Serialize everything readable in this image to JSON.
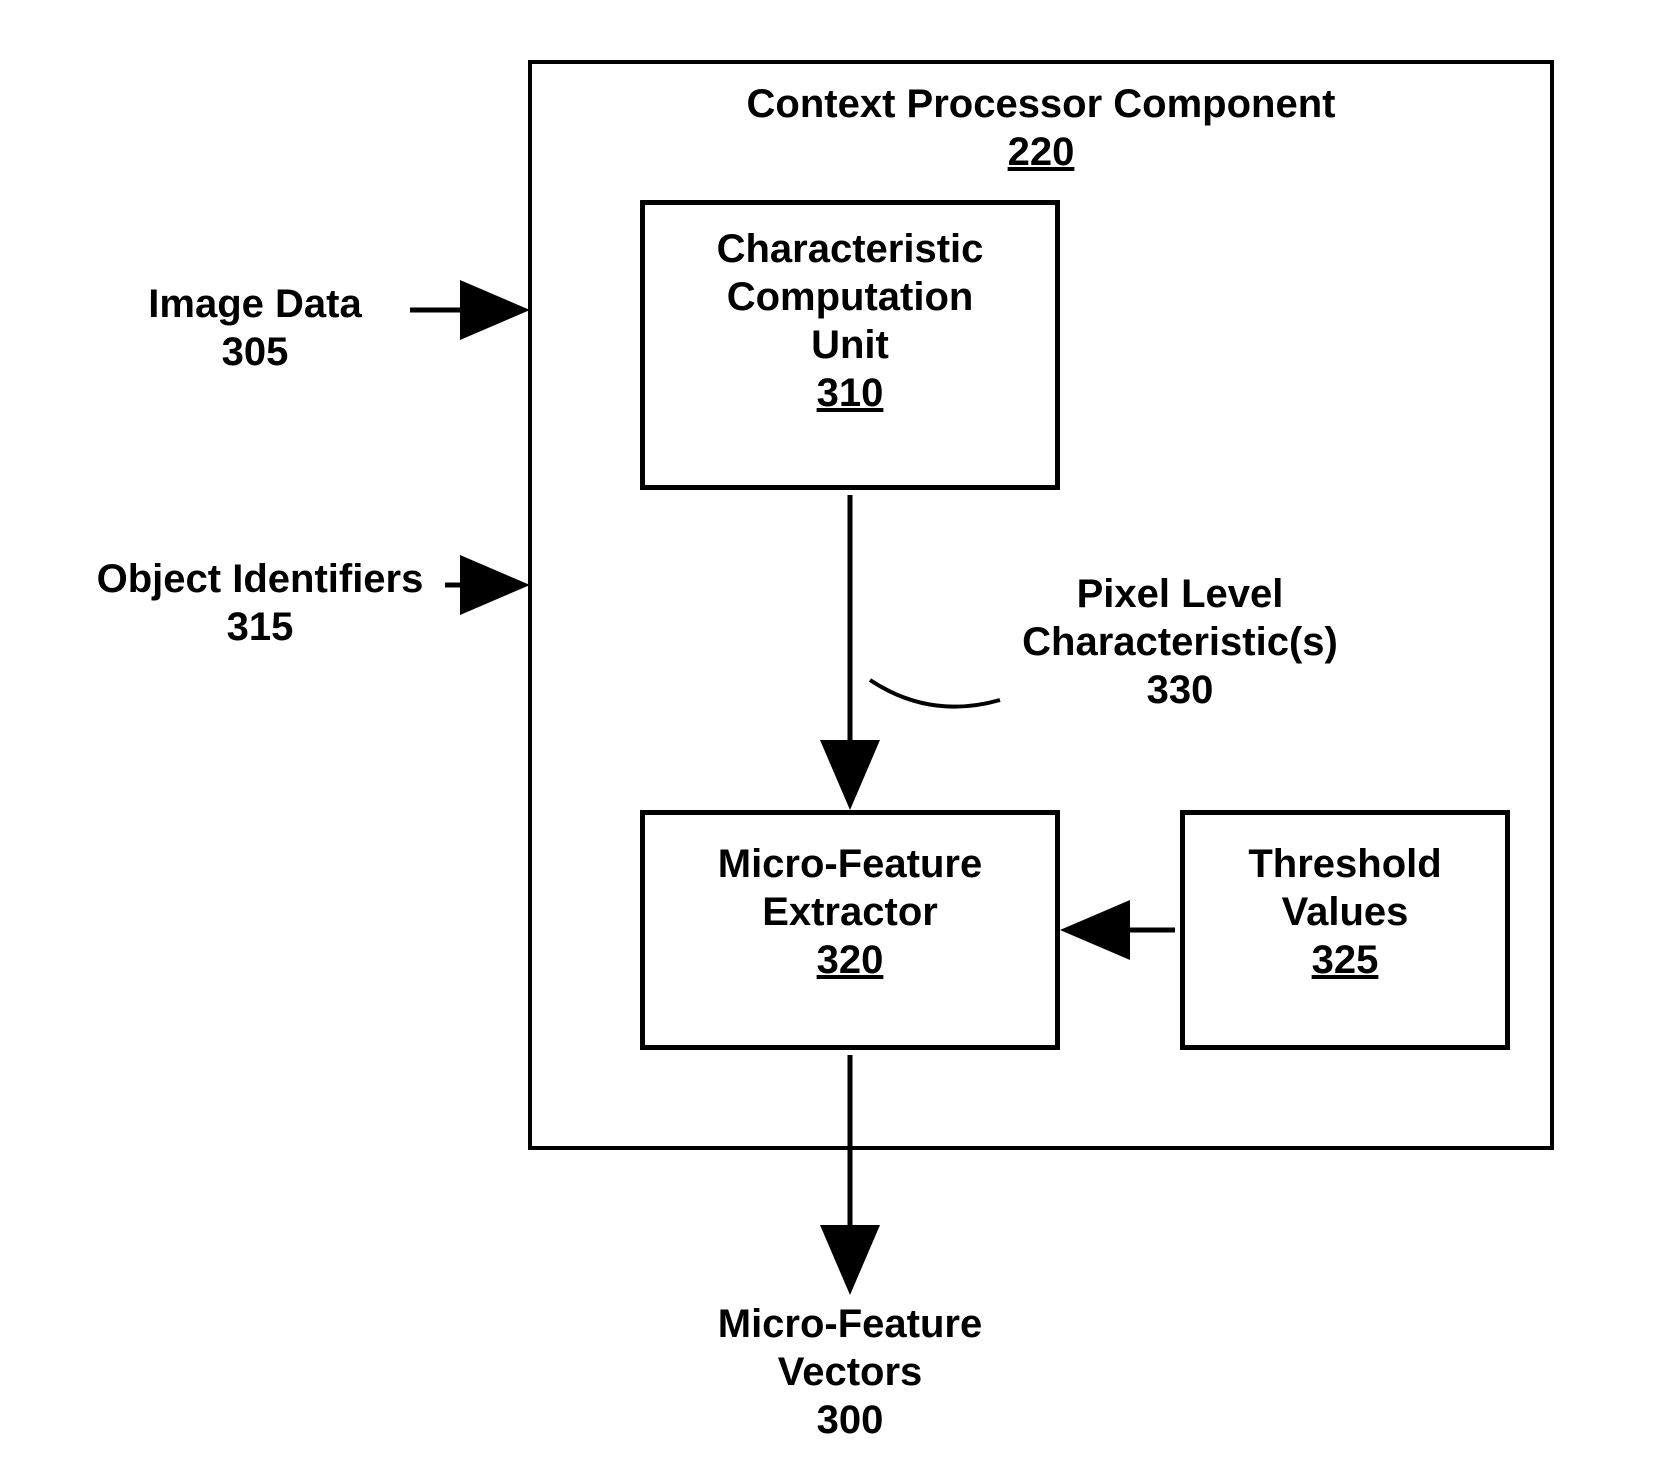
{
  "outer": {
    "title": "Context Processor Component",
    "ref": "220"
  },
  "ccu": {
    "line1": "Characteristic",
    "line2": "Computation",
    "line3": "Unit",
    "ref": "310"
  },
  "mfe": {
    "line1": "Micro-Feature",
    "line2": "Extractor",
    "ref": "320"
  },
  "thresh": {
    "line1": "Threshold",
    "line2": "Values",
    "ref": "325"
  },
  "imageData": {
    "line1": "Image Data",
    "ref": "305"
  },
  "objIds": {
    "line1": "Object Identifiers",
    "ref": "315"
  },
  "pixel": {
    "line1": "Pixel Level",
    "line2": "Characteristic(s)",
    "ref": "330"
  },
  "output": {
    "line1": "Micro-Feature",
    "line2": "Vectors",
    "ref": "300"
  }
}
